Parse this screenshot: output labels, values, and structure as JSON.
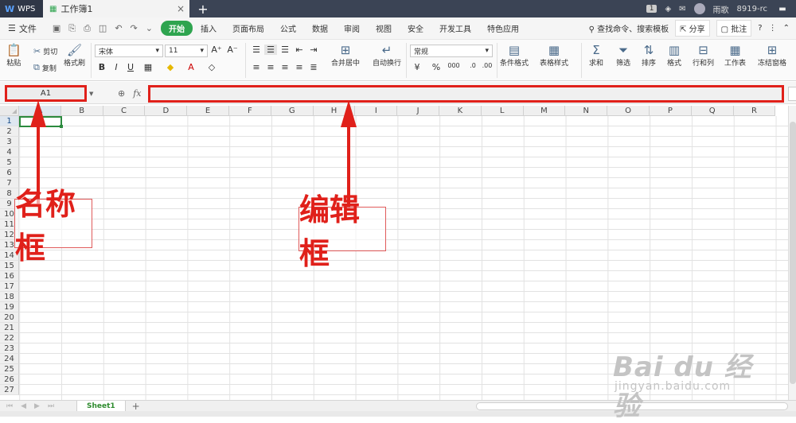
{
  "titlebar": {
    "brand": "WPS",
    "tab_label": "工作簿1",
    "page_badge": "1",
    "user_name": "雨歌",
    "user_id": "8919-rc"
  },
  "menubar": {
    "file_label": "文件",
    "tabs": [
      "开始",
      "插入",
      "页面布局",
      "公式",
      "数据",
      "审阅",
      "视图",
      "安全",
      "开发工具",
      "特色应用"
    ],
    "active_tab": "开始",
    "search": "查找命令、搜索模板",
    "share": "分享",
    "annotate": "批注"
  },
  "ribbon": {
    "paste": "粘贴",
    "cut": "剪切",
    "copy": "复制",
    "format_painter": "格式刷",
    "font_name": "宋体",
    "font_size": "11",
    "merge_center": "合并居中",
    "wrap_text": "自动换行",
    "number_format": "常规",
    "conditional_format": "条件格式",
    "table_style": "表格样式",
    "sum": "求和",
    "filter": "筛选",
    "sort": "排序",
    "format": "格式",
    "row_col": "行和列",
    "worksheet": "工作表",
    "freeze": "冻结窗格"
  },
  "formulabar": {
    "cell_ref": "A1",
    "fx_label": "fx",
    "formula_value": ""
  },
  "sheet": {
    "columns": [
      "A",
      "B",
      "C",
      "D",
      "E",
      "F",
      "G",
      "H",
      "I",
      "J",
      "K",
      "L",
      "M",
      "N",
      "O",
      "P",
      "Q",
      "R"
    ],
    "rows": [
      "1",
      "2",
      "3",
      "4",
      "5",
      "6",
      "7",
      "8",
      "9",
      "10",
      "11",
      "12",
      "13",
      "14",
      "15",
      "16",
      "17",
      "18",
      "19",
      "20",
      "21",
      "22",
      "23",
      "24",
      "25",
      "26",
      "27"
    ],
    "tabs": [
      "Sheet1"
    ]
  },
  "annotations": {
    "namebox_label": "名称框",
    "editbox_label": "编辑框",
    "accent_color": "#e0201a"
  },
  "watermark": {
    "line1": "Bai du 经验",
    "line2": "jingyan.baidu.com"
  }
}
